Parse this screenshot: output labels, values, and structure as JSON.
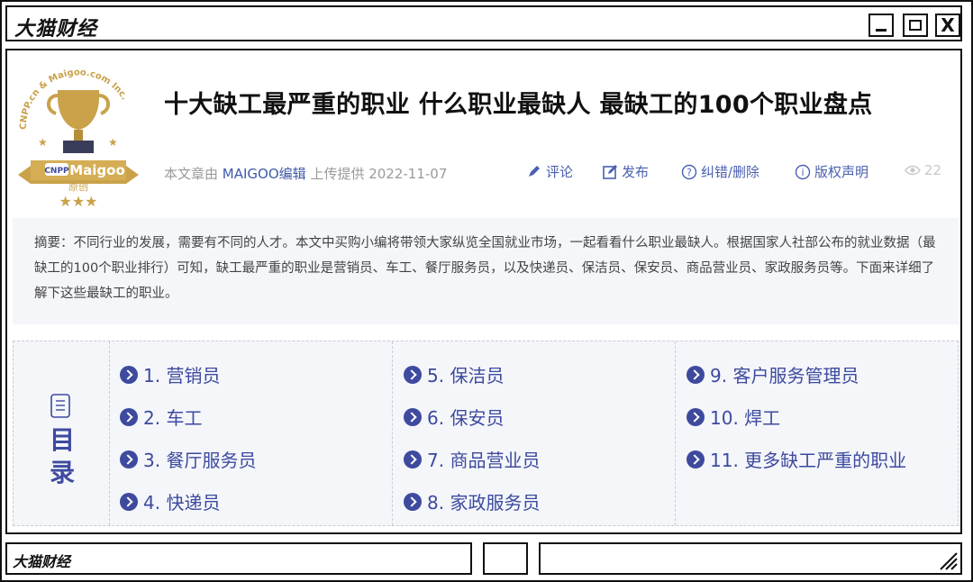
{
  "window": {
    "title": "大猫财经",
    "buttons": {
      "minimize": "minimize",
      "maximize": "maximize",
      "close": "X"
    }
  },
  "logo": {
    "ring_text": "CNPP.cn & Maigoo.com Inc.",
    "badge_left": "CNPP",
    "badge_right": "Maigoo",
    "sub": "原创",
    "stars": "★★★"
  },
  "article": {
    "title": "十大缺工最严重的职业 什么职业最缺人 最缺工的100个职业盘点",
    "meta_prefix": "本文章由",
    "editor": "MAIGOO编辑",
    "meta_suffix": "上传提供 2022-11-07",
    "actions": {
      "comment": "评论",
      "publish": "发布",
      "report": "纠错/删除",
      "copyright": "版权声明"
    },
    "views": "22",
    "summary": "摘要：不同行业的发展，需要有不同的人才。本文中买购小编将带领大家纵览全国就业市场，一起看看什么职业最缺人。根据国家人社部公布的就业数据（最缺工的100个职业排行）可知，缺工最严重的职业是营销员、车工、餐厅服务员，以及快递员、保洁员、保安员、商品营业员、家政服务员等。下面来详细了解下这些最缺工的职业。"
  },
  "toc": {
    "title": "目录",
    "columns": [
      [
        "1. 营销员",
        "2. 车工",
        "3. 餐厅服务员",
        "4. 快递员"
      ],
      [
        "5. 保洁员",
        "6. 保安员",
        "7. 商品营业员",
        "8. 家政服务员"
      ],
      [
        "9. 客户服务管理员",
        "10. 焊工",
        "11. 更多缺工严重的职业"
      ]
    ]
  },
  "statusbar": {
    "label": "大猫财经"
  },
  "colors": {
    "accent": "#3d4a9e",
    "link": "#4a5fb0",
    "gold": "#c9a24a",
    "summary_bg": "#f4f6fa"
  }
}
